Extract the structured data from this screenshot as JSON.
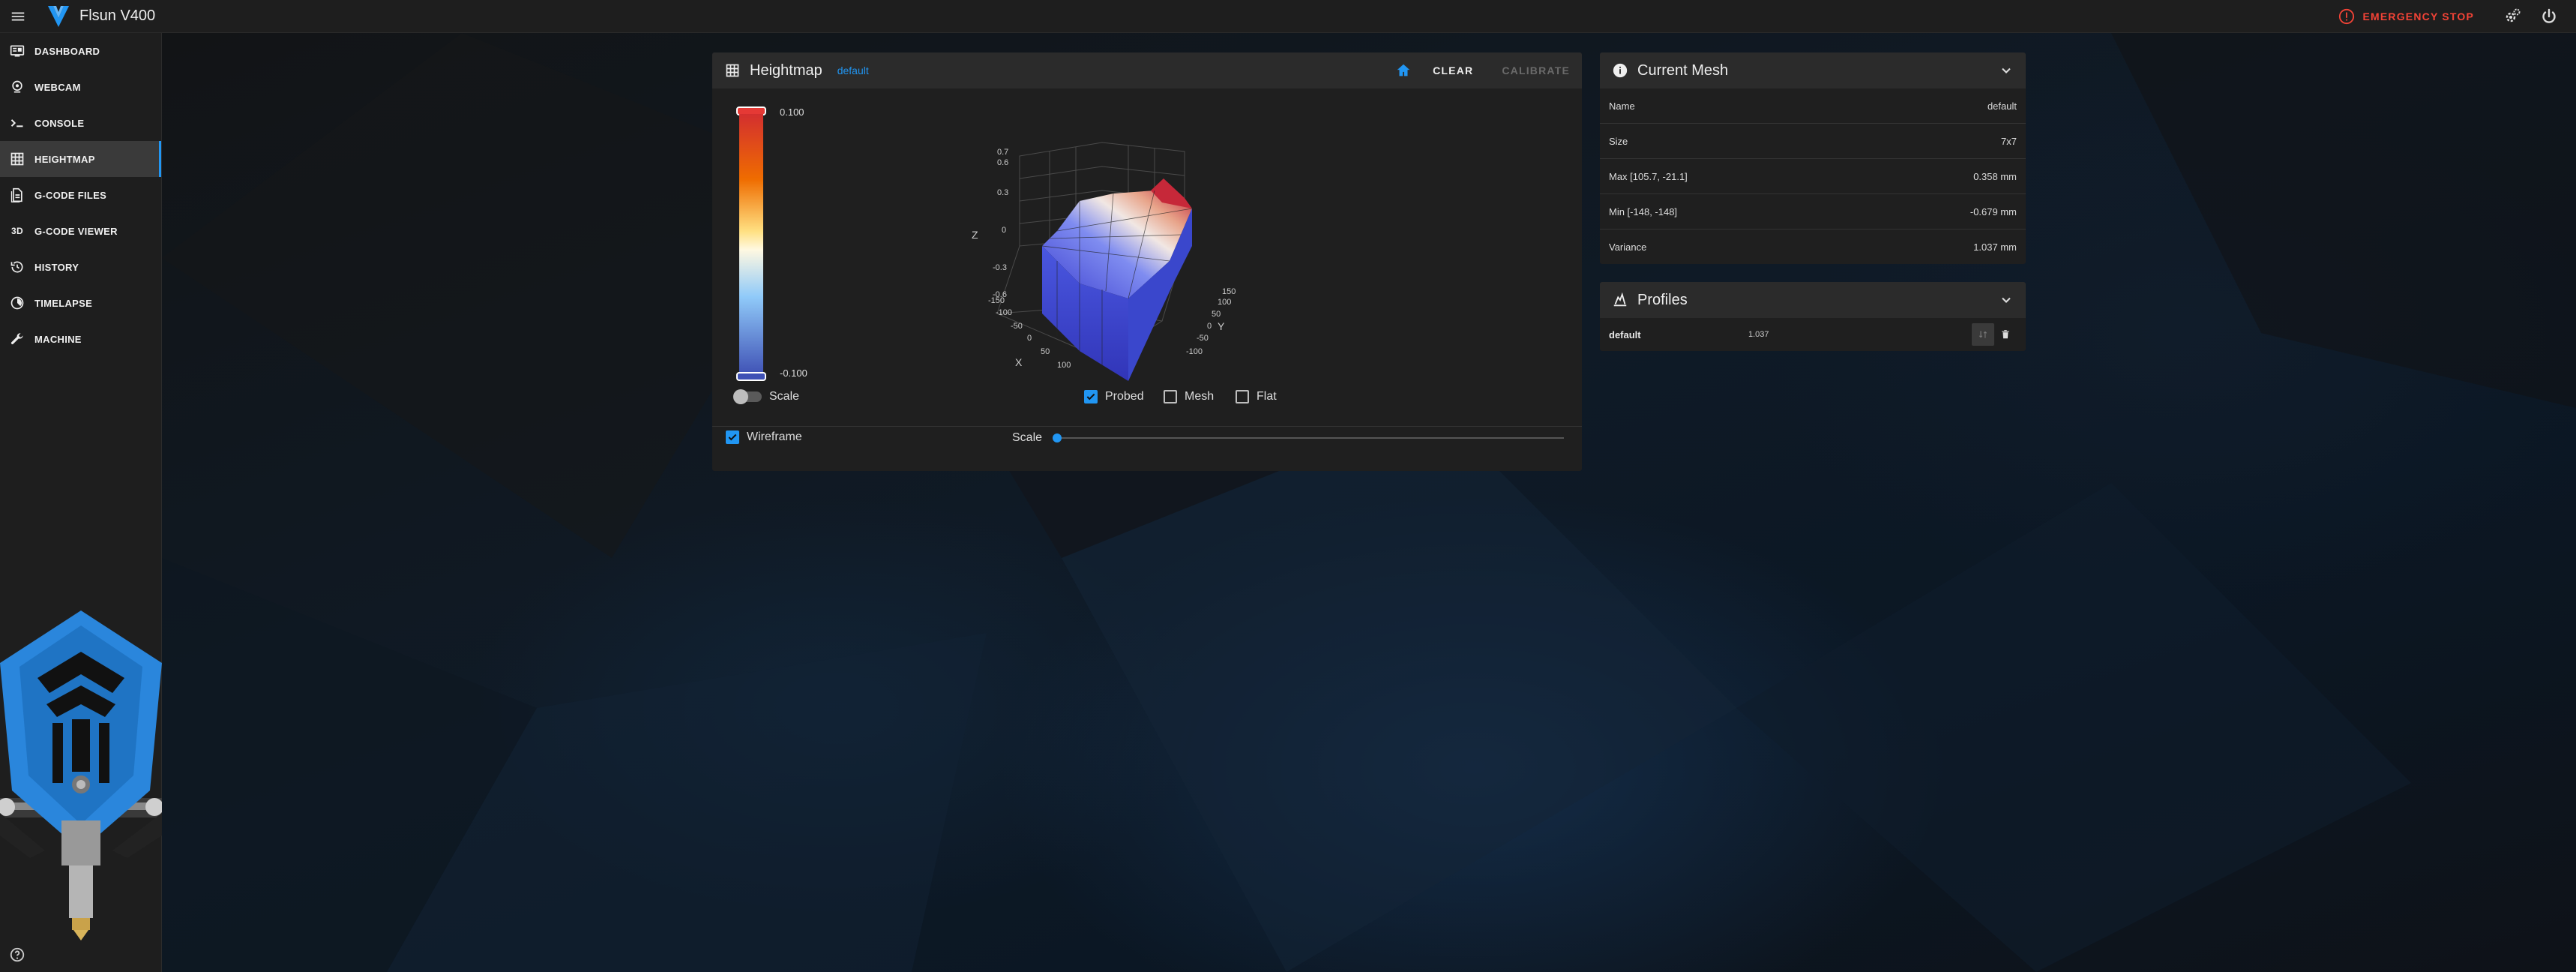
{
  "app": {
    "title": "Flsun V400",
    "emergency_stop": "EMERGENCY STOP"
  },
  "sidebar": {
    "items": [
      {
        "label": "DASHBOARD",
        "icon": "dashboard-icon"
      },
      {
        "label": "WEBCAM",
        "icon": "webcam-icon"
      },
      {
        "label": "CONSOLE",
        "icon": "console-icon"
      },
      {
        "label": "HEIGHTMAP",
        "icon": "grid-icon",
        "active": true
      },
      {
        "label": "G-CODE FILES",
        "icon": "files-icon"
      },
      {
        "label": "G-CODE VIEWER",
        "icon": "3d-icon",
        "glyph": "3D"
      },
      {
        "label": "HISTORY",
        "icon": "history-icon"
      },
      {
        "label": "TIMELAPSE",
        "icon": "timelapse-icon"
      },
      {
        "label": "MACHINE",
        "icon": "wrench-icon"
      }
    ]
  },
  "heightmap": {
    "title": "Heightmap",
    "profile": "default",
    "clear_label": "CLEAR",
    "calibrate_label": "CALIBRATE",
    "scale_max": "0.100",
    "scale_min": "-0.100",
    "scale_toggle_label": "Scale",
    "probed_label": "Probed",
    "mesh_label": "Mesh",
    "flat_label": "Flat",
    "wireframe_label": "Wireframe",
    "scale_slider_label": "Scale",
    "plot": {
      "z_label": "Z",
      "x_label": "X",
      "y_label": "Y",
      "z_ticks": [
        "0.7",
        "0.6",
        "0.3",
        "0",
        "-0.3",
        "-0.6"
      ],
      "x_ticks": [
        "-150",
        "-100",
        "-50",
        "0",
        "50",
        "100"
      ],
      "y_ticks": [
        "150",
        "100",
        "50",
        "0",
        "-50",
        "-100"
      ]
    }
  },
  "current_mesh": {
    "title": "Current Mesh",
    "rows": [
      {
        "label": "Name",
        "value": "default"
      },
      {
        "label": "Size",
        "value": "7x7"
      },
      {
        "label": "Max [105.7, -21.1]",
        "value": "0.358 mm"
      },
      {
        "label": "Min [-148, -148]",
        "value": "-0.679 mm"
      },
      {
        "label": "Variance",
        "value": "1.037 mm"
      }
    ]
  },
  "profiles": {
    "title": "Profiles",
    "items": [
      {
        "name": "default",
        "variance": "1.037"
      }
    ]
  },
  "colors": {
    "accent": "#2196f3",
    "danger": "#f44336",
    "panel": "#1f1f1f",
    "panel_header": "#2b2b2b"
  }
}
